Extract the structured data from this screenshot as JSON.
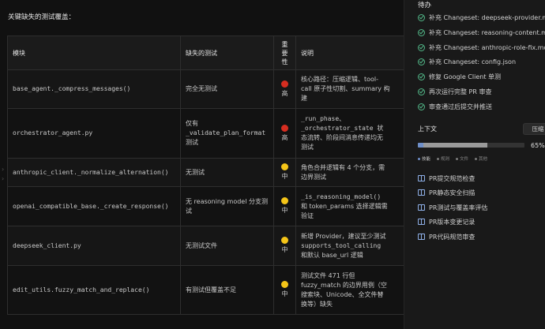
{
  "main": {
    "heading": "关键缺失的测试覆盖：",
    "table": {
      "headers": {
        "module": "模块",
        "missing": "缺失的测试",
        "severity_line1": "重",
        "severity_line2": "要",
        "severity_line3": "性",
        "desc": "说明"
      },
      "rows": [
        {
          "module": "base_agent._compress_messages()",
          "missing": "完全无测试",
          "severity_color": "#d62d20",
          "severity": "高",
          "desc_l1": "核心路径：压缩逻辑、tool-",
          "desc_l2": "call 原子性切割、summary 构",
          "desc_l3": "建"
        },
        {
          "module": "orchestrator_agent.py",
          "missing_l1": "仅有",
          "missing_l2": "_validate_plan_format",
          "missing_l3": "测试",
          "severity_color": "#d62d20",
          "severity": "高",
          "desc_l1": "_run_phase、",
          "desc_l2": "_orchestrator_state 状",
          "desc_l3": "态流转、阶段间消息传递均无",
          "desc_l4": "测试"
        },
        {
          "module": "anthropic_client._normalize_alternation()",
          "missing": "无测试",
          "severity_color": "#f5c518",
          "severity": "中",
          "desc_l1": "角色合并逻辑有 4 个分支，需",
          "desc_l2": "边界测试"
        },
        {
          "module": "openai_compatible_base._create_response()",
          "missing_l1": "无 reasoning model 分支测",
          "missing_l2": "试",
          "severity_color": "#f5c518",
          "severity": "中",
          "desc_l1": "_is_reasoning_model()",
          "desc_l2": "和 token_params 选择逻辑需",
          "desc_l3": "验证"
        },
        {
          "module": "deepseek_client.py",
          "missing": "无测试文件",
          "severity_color": "#f5c518",
          "severity": "中",
          "desc_l1": "新增 Provider，建议至少测试",
          "desc_l2": "supports_tool_calling",
          "desc_l3": "和默认 base_url 逻辑"
        },
        {
          "module": "edit_utils.fuzzy_match_and_replace()",
          "missing": "有测试但覆盖不足",
          "severity_color": "#f5c518",
          "severity": "中",
          "desc_l1": "测试文件 471 行但",
          "desc_l2": "fuzzy_match 的边界用例（空",
          "desc_l3": "搜索块、Unicode、全文件替",
          "desc_l4": "换等）缺失"
        }
      ]
    }
  },
  "sidebar": {
    "todo_title": "待办",
    "todos": [
      "补充 Changeset: deepseek-provider.md",
      "补充 Changeset: reasoning-content.md",
      "补充 Changeset: anthropic-role-fix.md",
      "补充 Changeset: config.json",
      "修复 Google Client 单测",
      "再次运行完整 PR 审查",
      "审查通过后提交并推送"
    ],
    "context": {
      "title": "上下文",
      "compress_label": "压缩",
      "percent": "65%",
      "progress_value": 0.65,
      "legend": [
        {
          "label": "技能",
          "color": "#6f8fc9"
        },
        {
          "label": "规则",
          "color": "#7a7a7a"
        },
        {
          "label": "文件",
          "color": "#7a7a7a"
        },
        {
          "label": "其他",
          "color": "#7a7a7a"
        }
      ]
    },
    "skills": [
      "PR提交规范检查",
      "PR静态安全扫描",
      "PR测试与覆盖率评估",
      "PR版本变更记录",
      "PR代码规范审查"
    ]
  }
}
